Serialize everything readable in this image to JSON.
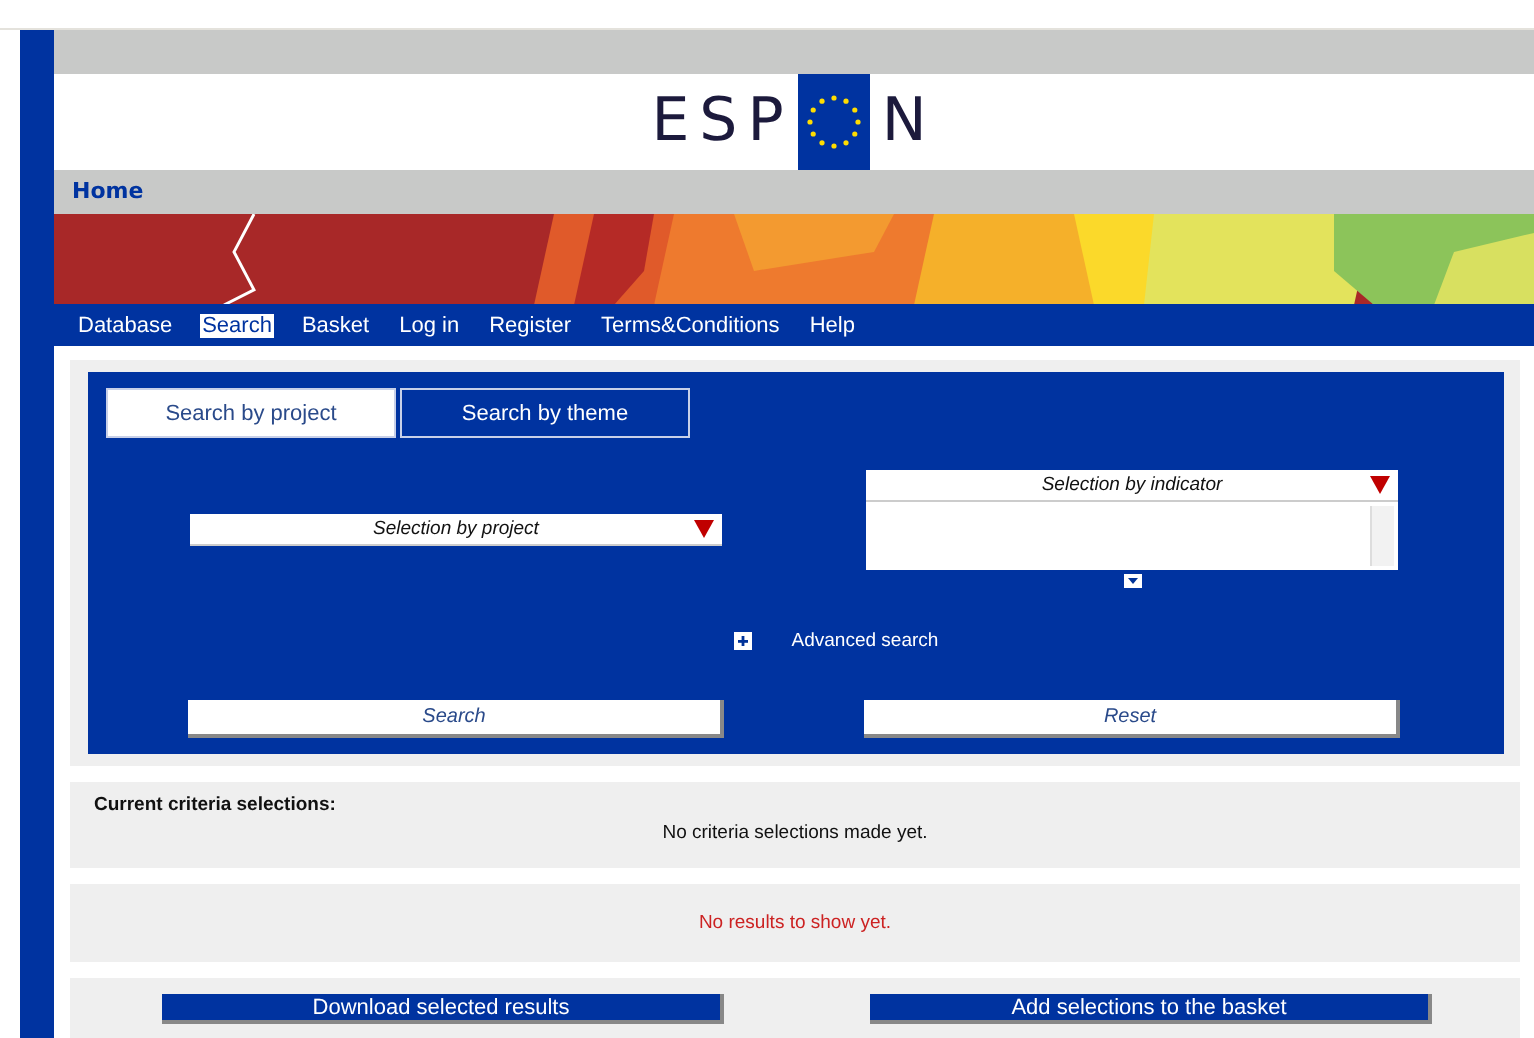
{
  "logo": {
    "left": "ESP",
    "right": "N"
  },
  "breadcrumb": "Home",
  "nav": [
    {
      "label": "Database",
      "selected": false
    },
    {
      "label": "Search",
      "selected": true
    },
    {
      "label": "Basket",
      "selected": false
    },
    {
      "label": "Log in",
      "selected": false
    },
    {
      "label": "Register",
      "selected": false
    },
    {
      "label": "Terms&Conditions",
      "selected": false
    },
    {
      "label": "Help",
      "selected": false
    }
  ],
  "tabs": [
    {
      "label": "Search by project",
      "selected": true
    },
    {
      "label": "Search by theme",
      "selected": false
    }
  ],
  "project_select": {
    "placeholder": "Selection by project"
  },
  "indicator_select": {
    "placeholder": "Selection by indicator"
  },
  "advanced_search": "Advanced search",
  "buttons": [
    "Search",
    "Reset"
  ],
  "criteria": {
    "title": "Current criteria selections:",
    "message": "No criteria selections made yet."
  },
  "results": {
    "message": "No results to show yet."
  },
  "actions": [
    "Download selected results",
    "Add selections to the basket"
  ]
}
